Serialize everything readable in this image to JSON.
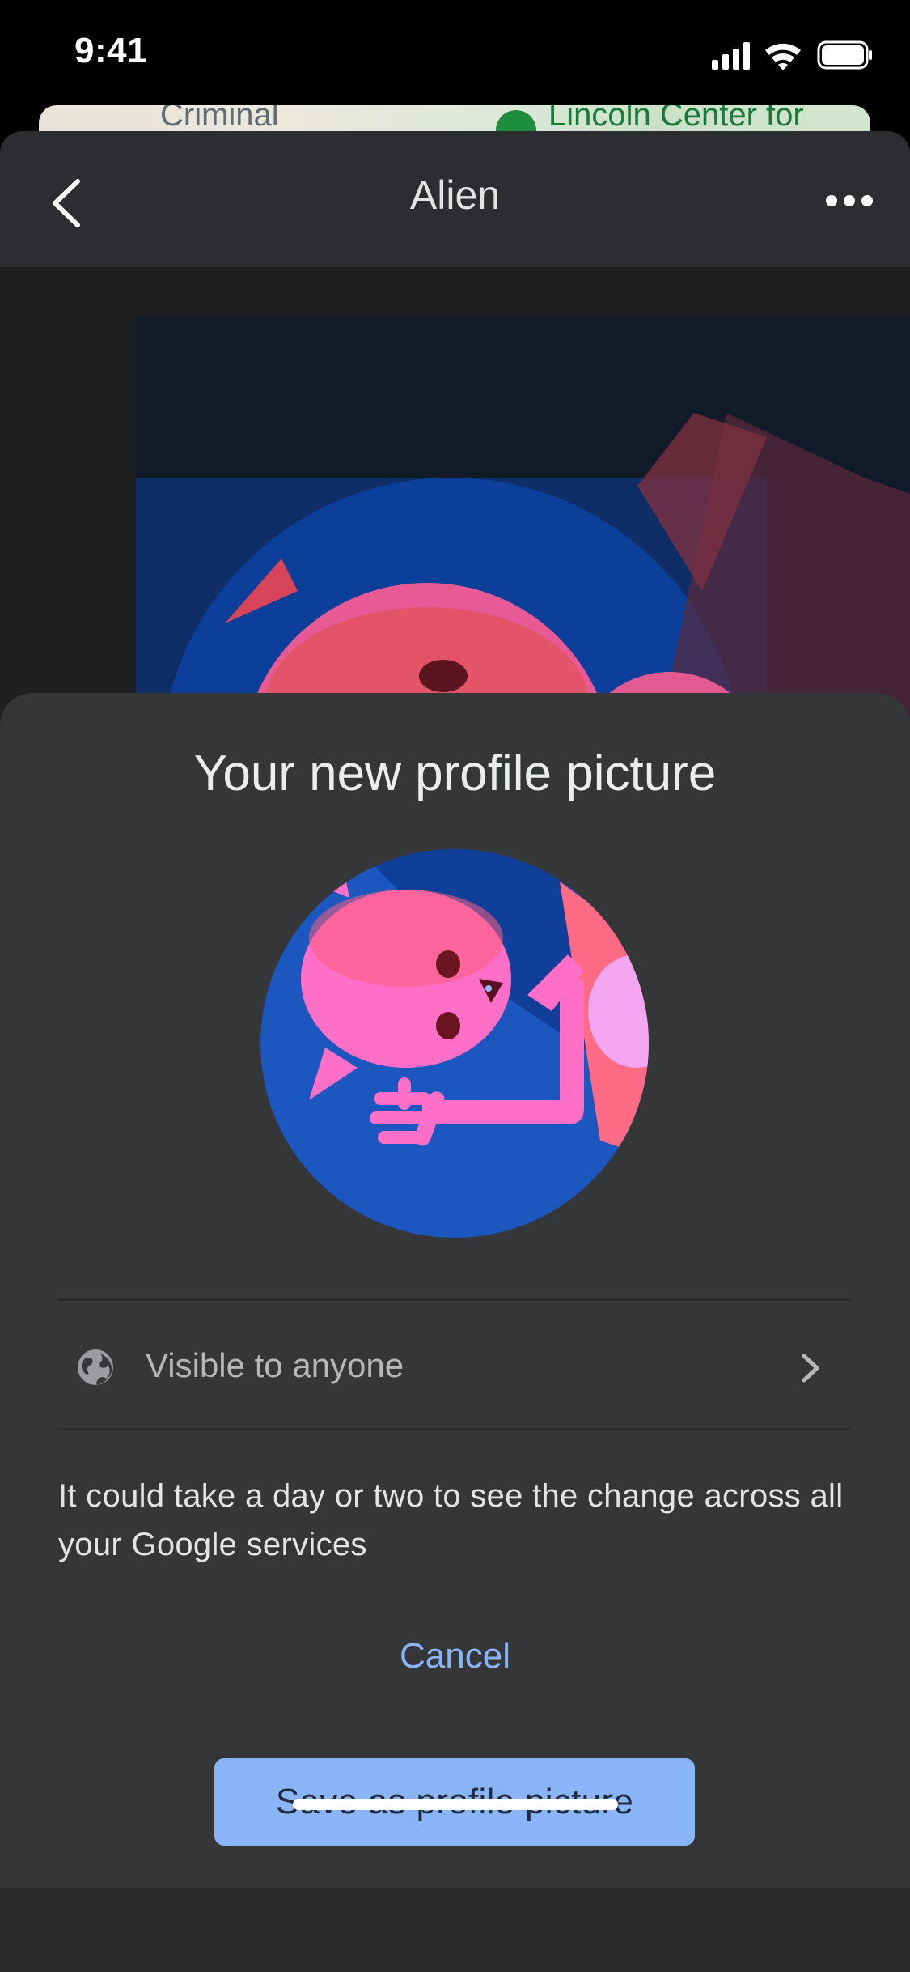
{
  "status_bar": {
    "time": "9:41"
  },
  "map_peek": {
    "label_left": "Criminal",
    "label_right": "Lincoln Center for"
  },
  "top_bar": {
    "title": "Alien",
    "back_icon": "chevron-left-icon",
    "more_icon": "more-horizontal-icon"
  },
  "dialog": {
    "title": "Your new profile picture",
    "visibility": {
      "icon": "globe-icon",
      "label": "Visible to anyone"
    },
    "note": "It could take a day or two to see the change across all your Google services",
    "cancel_label": "Cancel",
    "save_label": "Save as profile picture"
  },
  "colors": {
    "accent": "#8ab4f8",
    "sheet": "#353638",
    "avatar_bg": "#1b4fb0",
    "alien_pink": "#ff6ec7"
  }
}
